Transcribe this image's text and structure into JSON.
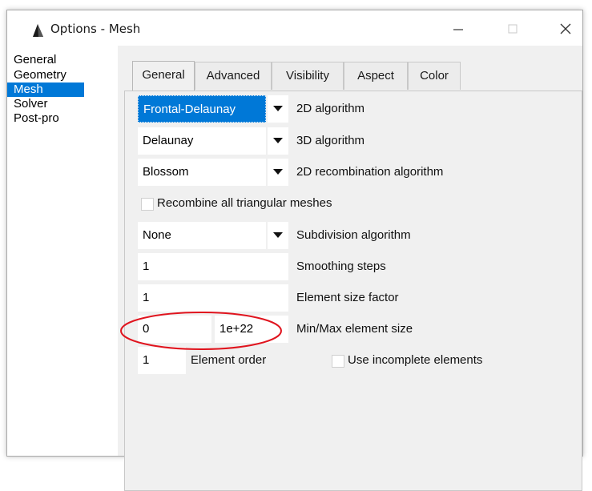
{
  "window": {
    "title": "Options - Mesh"
  },
  "sidebar": {
    "items": [
      {
        "label": "General",
        "selected": false
      },
      {
        "label": "Geometry",
        "selected": false
      },
      {
        "label": "Mesh",
        "selected": true
      },
      {
        "label": "Solver",
        "selected": false
      },
      {
        "label": "Post-pro",
        "selected": false
      }
    ]
  },
  "tabs": [
    {
      "label": "General",
      "active": true
    },
    {
      "label": "Advanced",
      "active": false
    },
    {
      "label": "Visibility",
      "active": false
    },
    {
      "label": "Aspect",
      "active": false
    },
    {
      "label": "Color",
      "active": false
    }
  ],
  "mesh_general": {
    "algo_2d": {
      "value": "Frontal-Delaunay",
      "label": "2D algorithm"
    },
    "algo_3d": {
      "value": "Delaunay",
      "label": "3D algorithm"
    },
    "recombination": {
      "value": "Blossom",
      "label": "2D recombination algorithm"
    },
    "recombine_all": {
      "label": "Recombine all triangular meshes",
      "checked": false
    },
    "subdivision": {
      "value": "None",
      "label": "Subdivision algorithm"
    },
    "smoothing": {
      "value": "1",
      "label": "Smoothing steps"
    },
    "size_factor": {
      "value": "1",
      "label": "Element size factor"
    },
    "min_size": {
      "value": "0"
    },
    "max_size": {
      "value": "1e+22"
    },
    "min_max_label": "Min/Max element size",
    "element_order": {
      "value": "1",
      "label": "Element order"
    },
    "incomplete": {
      "label": "Use incomplete elements",
      "checked": false
    }
  },
  "colors": {
    "selection": "#0078d7",
    "annotation": "#e0141e"
  },
  "icons": {
    "app": "gmsh-triangle-icon",
    "minimize": "minimize-icon",
    "maximize": "maximize-icon",
    "close": "close-icon",
    "dropdown": "triangle-down-icon"
  }
}
